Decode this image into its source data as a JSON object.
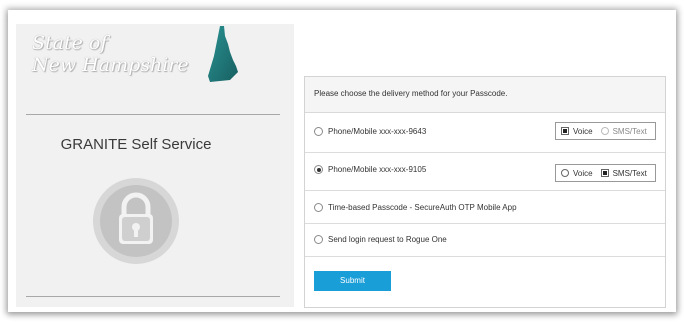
{
  "branding": {
    "line1": "State of",
    "line2": "New Hampshire"
  },
  "app": {
    "title": "GRANITE Self Service"
  },
  "form": {
    "prompt": "Please choose the delivery method for your Passcode.",
    "options": [
      {
        "label": "Phone/Mobile xxx-xxx-9643",
        "selected": false,
        "channels": {
          "voice": "Voice",
          "sms": "SMS/Text",
          "selected": "voice"
        }
      },
      {
        "label": "Phone/Mobile xxx-xxx-9105",
        "selected": true,
        "channels": {
          "voice": "Voice",
          "sms": "SMS/Text",
          "selected": "sms"
        }
      },
      {
        "label": "Time-based Passcode - SecureAuth OTP Mobile App",
        "selected": false
      },
      {
        "label": "Send login request to Rogue One",
        "selected": false
      }
    ],
    "submit_label": "Submit"
  },
  "colors": {
    "accent": "#1a9ed8",
    "state_shape": "#1f7a7a"
  },
  "icons": {
    "state": "new-hampshire-shape-icon",
    "lock": "padlock-icon"
  }
}
